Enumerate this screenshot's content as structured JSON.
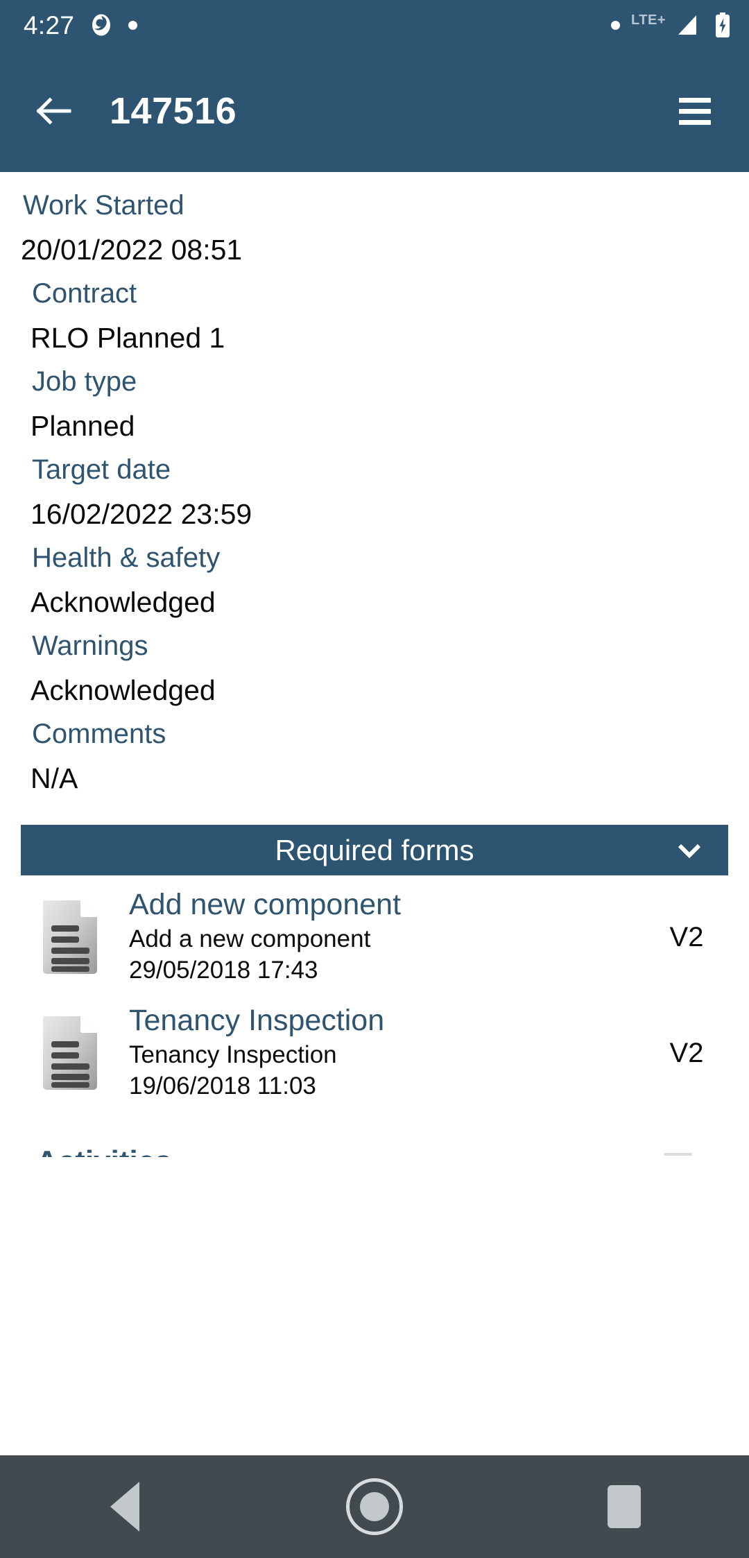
{
  "status_bar": {
    "clock": "4:27",
    "icons": [
      "aperture-icon",
      "dot-icon"
    ],
    "network_label": "LTE+",
    "right_icons": [
      "dot-icon",
      "signal-icon",
      "battery-charging-icon"
    ]
  },
  "app_bar": {
    "back_label": "back-arrow",
    "title": "147516",
    "menu_label": "menu"
  },
  "details": {
    "fields": [
      {
        "label": "Work Started",
        "value": "20/01/2022 08:51"
      },
      {
        "label": "Contract",
        "value": "RLO Planned 1"
      },
      {
        "label": "Job type",
        "value": "Planned"
      },
      {
        "label": "Target date",
        "value": "16/02/2022 23:59"
      },
      {
        "label": "Health & safety",
        "value": "Acknowledged"
      },
      {
        "label": "Warnings",
        "value": "Acknowledged"
      },
      {
        "label": "Comments",
        "value": "N/A"
      }
    ]
  },
  "required_forms": {
    "header": "Required forms",
    "expanded": true,
    "items": [
      {
        "title": "Add new component",
        "description": "Add a new component",
        "date": "29/05/2018 17:43",
        "version": "V2"
      },
      {
        "title": "Tenancy Inspection",
        "description": "Tenancy Inspection",
        "date": "19/06/2018 11:03",
        "version": "V2"
      }
    ]
  },
  "activities_section": {
    "header": "Activities"
  },
  "nav_bar": {
    "back": "back-triangle",
    "home": "home-circle",
    "recents": "recents-square"
  },
  "colors": {
    "primary": "#2d5470",
    "label": "#2f5470",
    "value": "#0b0b0b",
    "navbar": "#424a4f"
  }
}
